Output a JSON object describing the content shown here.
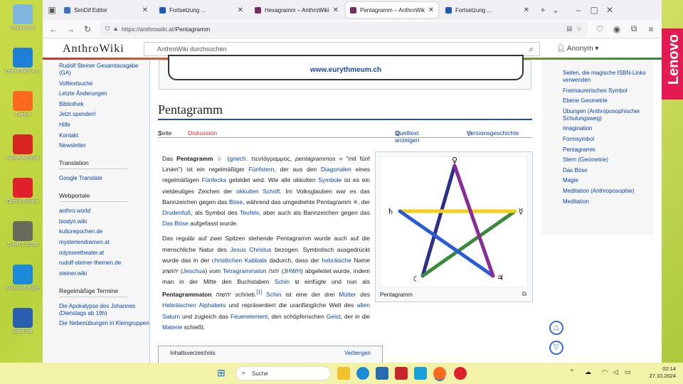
{
  "desktop": {
    "icons": [
      {
        "label": "Papierkorb",
        "color": "#7fb7e0"
      },
      {
        "label": "OpenOffice 4.1.",
        "color": "#1e7fd6"
      },
      {
        "label": "Firefox",
        "color": "#ff6a1f"
      },
      {
        "label": "Adobe Acrobat",
        "color": "#d6261f"
      },
      {
        "label": "Opera-Browse",
        "color": "#e0202a"
      },
      {
        "label": "GIMP 2.10.36",
        "color": "#6a6a5a"
      },
      {
        "label": "Microsoft Edge",
        "color": "#1c8ad6"
      },
      {
        "label": "paint.net",
        "color": "#2a5fb0"
      }
    ]
  },
  "lenovo": "Lenovo",
  "browser": {
    "tabs": [
      {
        "title": "SimDif Editor",
        "color": "#3a70c8"
      },
      {
        "title": "Fortsetzung ...",
        "color": "#1a5bb8"
      },
      {
        "title": "Hexagramm – AnthroWiki",
        "color": "#7b2b5e"
      },
      {
        "title": "Pentagramm – AnthroWiki",
        "color": "#7b2b5e",
        "active": true
      },
      {
        "title": "Fortsetzung ...",
        "color": "#1a5bb8"
      }
    ],
    "url_host": "https://anthrowiki.at/",
    "url_path": "Pentagramm"
  },
  "wiki": {
    "logo": "AnthroWiki",
    "search_placeholder": "AnthroWiki durchsuchen",
    "user": "Anonym",
    "banner_text": "www.eurythmeum.ch",
    "left_nav": {
      "top": [
        "Rudolf Steiner Gesamtausgabe (GA)",
        "Volltextsuche",
        "Letzte Änderungen",
        "Bibliothek",
        "Jetzt spenden!",
        "Hilfe",
        "Kontakt",
        "Newsletter"
      ],
      "translation_heading": "Translation",
      "translation": [
        "Google Translate"
      ],
      "portale_heading": "Webportale",
      "portale": [
        "anthro.world",
        "biodyn.wiki",
        "kulturepochen.de",
        "mysteriendramen.at",
        "odysseetheater.at",
        "rudolf-steiner-themen.de",
        "steiner.wiki"
      ],
      "termine_heading": "Regelmäßige Termine",
      "termine": [
        "Die Apokalypse des Johannes (Dienstags ab 19h)",
        "Die Nebenübungen in Kleingruppen"
      ]
    },
    "title": "Pentagramm",
    "tabs": {
      "seite": "Seite",
      "diskussion": "Diskussion",
      "quelltext": "Quelltext anzeigen",
      "versionen": "Versionsgeschichte"
    },
    "paragraph1": [
      {
        "t": "Das "
      },
      {
        "t": "Pentagramm",
        "b": true
      },
      {
        "t": " ☆ ("
      },
      {
        "t": "griech.",
        "a": true
      },
      {
        "t": " πεντάγραμμος, "
      },
      {
        "t": "pentágrammos",
        "i": true
      },
      {
        "t": " = \"mit fünf Linien\") ist ein regelmäßiger "
      },
      {
        "t": "Fünfstern",
        "a": true
      },
      {
        "t": ", der aus den "
      },
      {
        "t": "Diagonalen",
        "a": true
      },
      {
        "t": " eines regelmäßigen "
      },
      {
        "t": "Fünfecks",
        "a": true
      },
      {
        "t": " gebildet wird. Wie alle okkulten "
      },
      {
        "t": "Symbole",
        "a": true
      },
      {
        "t": " ist es ein vieldeutiges Zeichen der "
      },
      {
        "t": "okkulten Schrift",
        "a": true
      },
      {
        "t": ". Im Volksglauben war es das Bannzeichen gegen das "
      },
      {
        "t": "Böse",
        "a": true
      },
      {
        "t": ", während das umgedrehte Pentagramm ⛧, der "
      },
      {
        "t": "Drudenfuß",
        "a": true
      },
      {
        "t": ", als Symbol des "
      },
      {
        "t": "Teufels",
        "a": true
      },
      {
        "t": ", aber auch als Bannzeichen gegen das "
      },
      {
        "t": "Das Böse",
        "a": true
      },
      {
        "t": " aufgefasst wurde."
      }
    ],
    "paragraph2": [
      {
        "t": "Das regulär auf zwei Spitzen stehende Pentagramm wurde auch auf die menschliche Natur des "
      },
      {
        "t": "Jesus Christus",
        "a": true
      },
      {
        "t": " bezogen. Symbolisch ausgedrückt wurde das in der "
      },
      {
        "t": "christlichen Kabbala",
        "a": true
      },
      {
        "t": " dadurch, dass der "
      },
      {
        "t": "hebräische",
        "a": true
      },
      {
        "t": " Name יהושוע ("
      },
      {
        "t": "Jeschua",
        "a": true
      },
      {
        "t": ") vom "
      },
      {
        "t": "Tetragrammaton",
        "a": true
      },
      {
        "t": " יהוה ("
      },
      {
        "t": "JHWH",
        "a": true
      },
      {
        "t": ") abgeleitet wurde, indem man in der Mitte den Buchstaben "
      },
      {
        "t": "Schin",
        "a": true
      },
      {
        "t": " ש einfügte und nun als "
      },
      {
        "t": "Pentagrammaton",
        "b": true
      },
      {
        "t": " יהשוה schrieb."
      },
      {
        "t": "[1]",
        "sup": true
      },
      {
        "t": " "
      },
      {
        "t": "Schin",
        "a": true
      },
      {
        "t": " ist eine der drei "
      },
      {
        "t": "Mütter",
        "a": true
      },
      {
        "t": " des "
      },
      {
        "t": "Hebräischen Alphabets",
        "a": true
      },
      {
        "t": " und repräsentiert die uranfängliche Welt des "
      },
      {
        "t": "alten Saturn",
        "a": true
      },
      {
        "t": " und zugleich das "
      },
      {
        "t": "Feuerelement",
        "a": true
      },
      {
        "t": ", den schöpferischen "
      },
      {
        "t": "Geist",
        "a": true
      },
      {
        "t": ", der in die "
      },
      {
        "t": "Materie",
        "a": true
      },
      {
        "t": " schießt."
      }
    ],
    "figure": {
      "caption": "Pentagramm",
      "symbols": [
        "♀",
        "♄",
        "☿",
        "☾",
        "♃"
      ],
      "edge_colors": [
        "#2c2f8a",
        "#3a8a3a",
        "#f2d21a",
        "#2a5bd8",
        "#8a2a9a"
      ]
    },
    "toc": {
      "title": "Inhaltsverzeichnis",
      "toggle": "Verbergen"
    },
    "right_nav": [
      "Seiten, die magische ISBN-Links verwenden",
      "Freimaurerisches Symbol",
      "Ebene Geometrie",
      "Übungen (Anthroposophischer Schulungsweg)",
      "Imagination",
      "Formsymbol",
      "Pentagramm",
      "Stern (Geometrie)",
      "Das Böse",
      "Magie",
      "Meditation (Anthroposophie)",
      "Meditation"
    ]
  },
  "taskbar": {
    "search": "Suche",
    "time": "02:14",
    "date": "27.10.2024"
  }
}
